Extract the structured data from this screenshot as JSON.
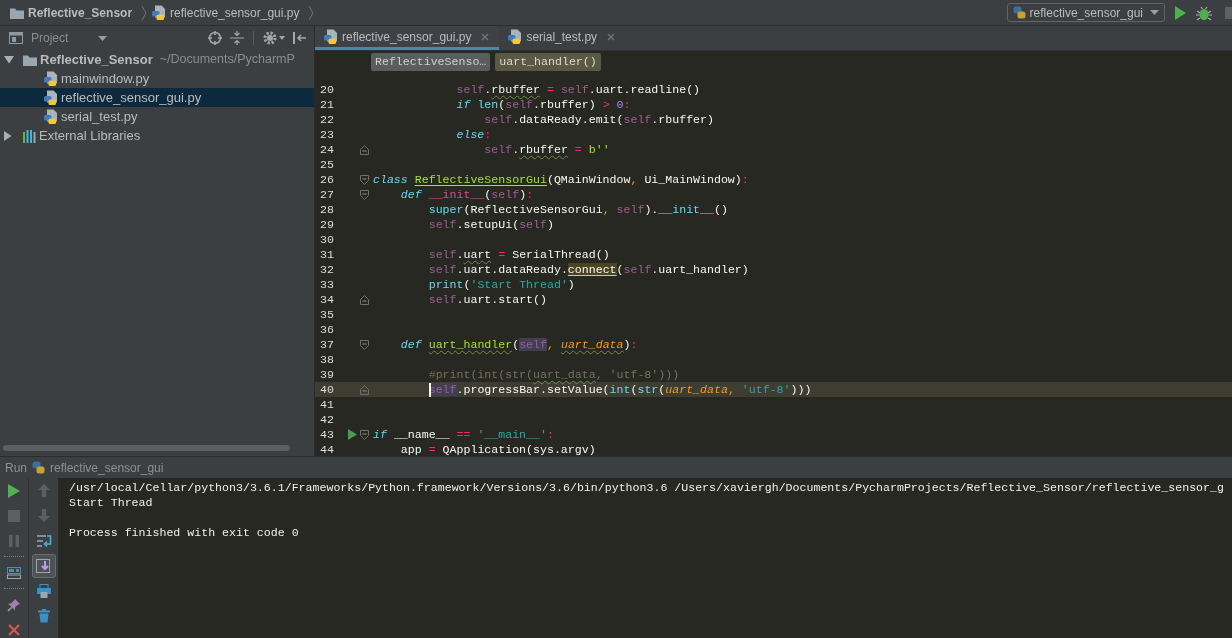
{
  "navbar": {
    "breadcrumbs": [
      {
        "label": "Reflective_Sensor",
        "kind": "folder"
      },
      {
        "label": "reflective_sensor_gui.py",
        "kind": "python"
      }
    ],
    "run_config": {
      "label": "reflective_sensor_gui"
    },
    "actions": [
      {
        "kind": "run",
        "disabled": false
      },
      {
        "kind": "debug",
        "disabled": false
      },
      {
        "kind": "stop",
        "disabled": true
      }
    ]
  },
  "project_panel": {
    "title": "Project",
    "tree": [
      {
        "label": "Reflective_Sensor",
        "path": "~/Documents/PycharmP",
        "kind": "folder",
        "expanded": true,
        "selected": false,
        "children": [
          {
            "label": "mainwindow.py",
            "kind": "python",
            "selected": false
          },
          {
            "label": "reflective_sensor_gui.py",
            "kind": "python",
            "selected": true
          },
          {
            "label": "serial_test.py",
            "kind": "python",
            "selected": false
          }
        ]
      },
      {
        "label": "External Libraries",
        "kind": "library",
        "expanded": false,
        "selected": false
      }
    ]
  },
  "editor": {
    "tabs": [
      {
        "label": "reflective_sensor_gui.py",
        "selected": true
      },
      {
        "label": "serial_test.py",
        "selected": false
      }
    ],
    "breadcrumbs": [
      {
        "label": "ReflectiveSenso…",
        "kind": "class"
      },
      {
        "label": "uart_handler()",
        "kind": "function"
      }
    ],
    "lines": [
      {
        "number": "20",
        "current": false,
        "tokens": [
          {
            "text": "            self",
            "kind": "self"
          },
          {
            "text": ".",
            "kind": "plain"
          },
          {
            "text": "rbuffer",
            "kind": "plain",
            "typo": true
          },
          {
            "text": " = ",
            "kind": "operator"
          },
          {
            "text": "self",
            "kind": "self"
          },
          {
            "text": ".uart.readline()",
            "kind": "plain"
          }
        ]
      },
      {
        "number": "21",
        "current": false,
        "tokens": [
          {
            "text": "            if ",
            "kind": "keyword"
          },
          {
            "text": "len",
            "kind": "builtin"
          },
          {
            "text": "(",
            "kind": "plain"
          },
          {
            "text": "self",
            "kind": "self"
          },
          {
            "text": ".rbuffer) ",
            "kind": "plain"
          },
          {
            "text": "> ",
            "kind": "operator"
          },
          {
            "text": "0",
            "kind": "number"
          },
          {
            "text": ":",
            "kind": "operator"
          }
        ]
      },
      {
        "number": "22",
        "current": false,
        "tokens": [
          {
            "text": "                self",
            "kind": "self"
          },
          {
            "text": ".dataReady.emit(",
            "kind": "plain"
          },
          {
            "text": "self",
            "kind": "self"
          },
          {
            "text": ".rbuffer)",
            "kind": "plain"
          }
        ]
      },
      {
        "number": "23",
        "current": false,
        "tokens": [
          {
            "text": "            else",
            "kind": "keyword"
          },
          {
            "text": ":",
            "kind": "operator"
          }
        ]
      },
      {
        "number": "24",
        "current": false,
        "fold_end": true,
        "tokens": [
          {
            "text": "                self",
            "kind": "self"
          },
          {
            "text": ".",
            "kind": "plain"
          },
          {
            "text": "rbuffer",
            "kind": "plain",
            "typo": true
          },
          {
            "text": " = ",
            "kind": "operator"
          },
          {
            "text": "b''",
            "kind": "bytes"
          }
        ]
      },
      {
        "number": "25",
        "current": false
      },
      {
        "number": "26",
        "current": false,
        "fold_start": true,
        "tokens": [
          {
            "text": "class ",
            "kind": "keyword"
          },
          {
            "text": "ReflectiveSensorGui",
            "kind": "classname"
          },
          {
            "text": "(QMainWindow",
            "kind": "plain"
          },
          {
            "text": ", ",
            "kind": "punct"
          },
          {
            "text": "Ui_MainWindow)",
            "kind": "plain"
          },
          {
            "text": ":",
            "kind": "operator"
          }
        ]
      },
      {
        "number": "27",
        "current": false,
        "fold_start": true,
        "tokens": [
          {
            "text": "    def ",
            "kind": "keyword"
          },
          {
            "text": "__init__",
            "kind": "magic"
          },
          {
            "text": "(",
            "kind": "plain"
          },
          {
            "text": "self",
            "kind": "self"
          },
          {
            "text": ")",
            "kind": "plain"
          },
          {
            "text": ":",
            "kind": "operator"
          }
        ]
      },
      {
        "number": "28",
        "current": false,
        "tokens": [
          {
            "text": "        super",
            "kind": "builtin"
          },
          {
            "text": "(ReflectiveSensorGui",
            "kind": "plain"
          },
          {
            "text": ", ",
            "kind": "punct"
          },
          {
            "text": "self",
            "kind": "self"
          },
          {
            "text": ").",
            "kind": "plain"
          },
          {
            "text": "__init__",
            "kind": "magiccall"
          },
          {
            "text": "()",
            "kind": "plain"
          }
        ]
      },
      {
        "number": "29",
        "current": false,
        "tokens": [
          {
            "text": "        self",
            "kind": "self"
          },
          {
            "text": ".setupUi(",
            "kind": "plain"
          },
          {
            "text": "self",
            "kind": "self"
          },
          {
            "text": ")",
            "kind": "plain"
          }
        ]
      },
      {
        "number": "30",
        "current": false
      },
      {
        "number": "31",
        "current": false,
        "tokens": [
          {
            "text": "        self",
            "kind": "self"
          },
          {
            "text": ".",
            "kind": "plain"
          },
          {
            "text": "uart",
            "kind": "plain",
            "typo": true
          },
          {
            "text": " = ",
            "kind": "operator"
          },
          {
            "text": "SerialThread()",
            "kind": "plain"
          }
        ]
      },
      {
        "number": "32",
        "current": false,
        "tokens": [
          {
            "text": "        self",
            "kind": "self"
          },
          {
            "text": ".uart.dataReady.",
            "kind": "plain"
          },
          {
            "text": "connect",
            "kind": "plain",
            "matched": true
          },
          {
            "text": "(",
            "kind": "plain"
          },
          {
            "text": "self",
            "kind": "self"
          },
          {
            "text": ".uart_handler)",
            "kind": "plain"
          }
        ]
      },
      {
        "number": "33",
        "current": false,
        "tokens": [
          {
            "text": "        print",
            "kind": "builtin"
          },
          {
            "text": "(",
            "kind": "plain"
          },
          {
            "text": "'Start Thread'",
            "kind": "string"
          },
          {
            "text": ")",
            "kind": "plain"
          }
        ]
      },
      {
        "number": "34",
        "current": false,
        "fold_end": true,
        "tokens": [
          {
            "text": "        self",
            "kind": "self"
          },
          {
            "text": ".uart.start()",
            "kind": "plain"
          }
        ]
      },
      {
        "number": "35",
        "current": false
      },
      {
        "number": "36",
        "current": false
      },
      {
        "number": "37",
        "current": false,
        "fold_start": true,
        "tokens": [
          {
            "text": "    def ",
            "kind": "keyword"
          },
          {
            "text": "uart_handler",
            "kind": "defname",
            "typo": true
          },
          {
            "text": "(",
            "kind": "plain"
          },
          {
            "text": "self",
            "kind": "self",
            "highlighted": true
          },
          {
            "text": ", ",
            "kind": "punct"
          },
          {
            "text": "uart_data",
            "kind": "param",
            "typo": true
          },
          {
            "text": ")",
            "kind": "plain"
          },
          {
            "text": ":",
            "kind": "operator"
          }
        ]
      },
      {
        "number": "38",
        "current": false
      },
      {
        "number": "39",
        "current": false,
        "tokens": [
          {
            "text": "        #print(int(str(",
            "kind": "comment"
          },
          {
            "text": "uart_data",
            "kind": "comment",
            "typo": true
          },
          {
            "text": ", 'utf-8')))",
            "kind": "comment"
          }
        ]
      },
      {
        "number": "40",
        "current": true,
        "fold_end": true,
        "tokens": [
          {
            "text": "        self",
            "kind": "self",
            "highlighted": true
          },
          {
            "text": ".progressBar.setValue(",
            "kind": "plain"
          },
          {
            "text": "int",
            "kind": "builtin"
          },
          {
            "text": "(",
            "kind": "plain"
          },
          {
            "text": "str",
            "kind": "builtin"
          },
          {
            "text": "(",
            "kind": "plain"
          },
          {
            "text": "uart_data",
            "kind": "param"
          },
          {
            "text": ", ",
            "kind": "punct"
          },
          {
            "text": "'utf-8'",
            "kind": "string"
          },
          {
            "text": ")))",
            "kind": "plain"
          }
        ]
      },
      {
        "number": "41",
        "current": false
      },
      {
        "number": "42",
        "current": false
      },
      {
        "number": "43",
        "current": false,
        "run": true,
        "fold_start": true,
        "tokens": [
          {
            "text": "if",
            "kind": "keyword"
          },
          {
            "text": " __name__ ",
            "kind": "plain"
          },
          {
            "text": "== ",
            "kind": "operator"
          },
          {
            "text": "'__main__'",
            "kind": "string"
          },
          {
            "text": ":",
            "kind": "operator"
          }
        ]
      },
      {
        "number": "44",
        "current": false,
        "tokens": [
          {
            "text": "    app",
            "kind": "plain"
          },
          {
            "text": " = ",
            "kind": "operator"
          },
          {
            "text": "QApplication(sys.argv)",
            "kind": "plain"
          }
        ]
      }
    ]
  },
  "run_panel": {
    "title": "Run",
    "config": "reflective_sensor_gui",
    "toolbar_groups": [
      {
        "buttons": [
          {
            "kind": "run",
            "disabled": false
          },
          {
            "kind": "stop",
            "disabled": true
          },
          {
            "kind": "pause",
            "disabled": true
          }
        ]
      },
      {
        "buttons": [
          {
            "kind": "layout",
            "disabled": false
          }
        ]
      },
      {
        "buttons": [
          {
            "kind": "pin",
            "disabled": false
          },
          {
            "kind": "close",
            "disabled": false
          }
        ]
      }
    ],
    "side_toolbar": [
      {
        "kind": "up",
        "disabled": true,
        "on": false
      },
      {
        "kind": "down",
        "disabled": true,
        "on": false
      },
      {
        "kind": "wrap",
        "disabled": false,
        "on": false
      },
      {
        "kind": "scroll",
        "disabled": false,
        "on": true
      },
      {
        "kind": "print",
        "disabled": false,
        "on": false
      },
      {
        "kind": "trash",
        "disabled": false,
        "on": false
      }
    ],
    "console": [
      {
        "text": "/usr/local/Cellar/python3/3.6.1/Frameworks/Python.framework/Versions/3.6/bin/python3.6 /Users/xaviergh/Documents/PycharmProjects/Reflective_Sensor/reflective_sensor_g",
        "kind": "command"
      },
      {
        "text": "Start Thread",
        "kind": "output"
      },
      {
        "text": "Process finished with exit code 0",
        "kind": "status"
      }
    ]
  }
}
